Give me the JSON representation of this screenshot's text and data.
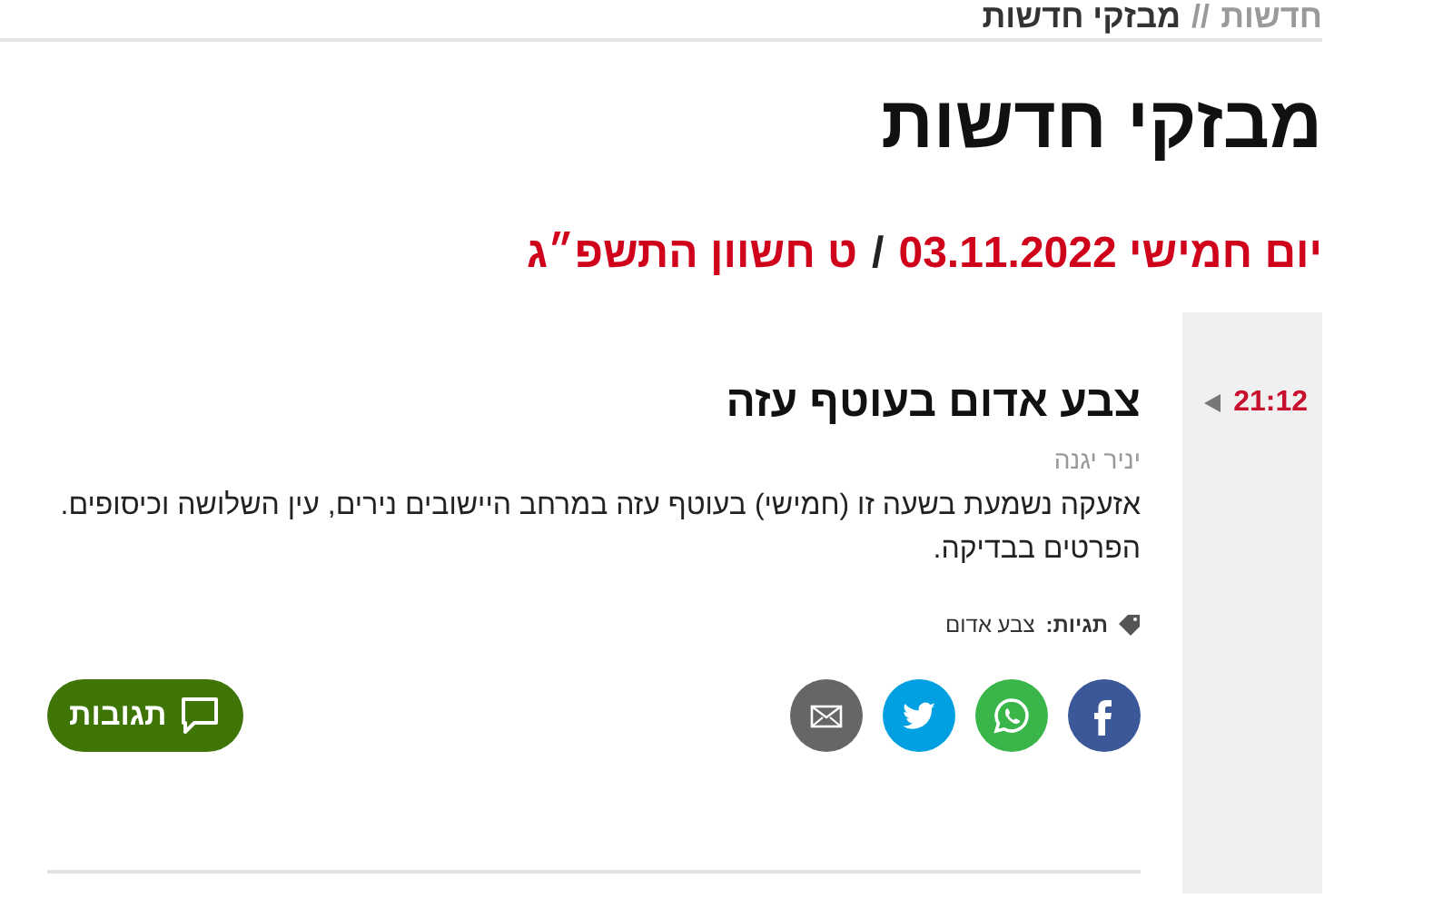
{
  "breadcrumb": [
    {
      "label": "חדשות",
      "current": false
    },
    {
      "label": "מבזקי חדשות",
      "current": true
    }
  ],
  "breadcrumb_separator": "//",
  "title": "מבזקי חדשות",
  "date": {
    "weekday_date": "יום חמישי 03.11.2022",
    "separator": "/",
    "hebrew_date": "ט חשוון התשפ״ג"
  },
  "flash": {
    "time": "21:12",
    "headline": "צבע אדום בעוטף עזה",
    "author": "יניר יגנה",
    "body": "אזעקה נשמעת בשעה זו (חמישי) בעוטף עזה במרחב היישובים נירים, עין השלושה וכיסופים. הפרטים בבדיקה.",
    "tags_label": "תגיות:",
    "tags": [
      "צבע אדום"
    ]
  },
  "share": [
    {
      "kind": "facebook",
      "color": "#3b5998"
    },
    {
      "kind": "whatsapp",
      "color": "#3ab54a"
    },
    {
      "kind": "twitter",
      "color": "#00a0e3"
    },
    {
      "kind": "email",
      "color": "#666666"
    }
  ],
  "comments_button": "תגובות"
}
